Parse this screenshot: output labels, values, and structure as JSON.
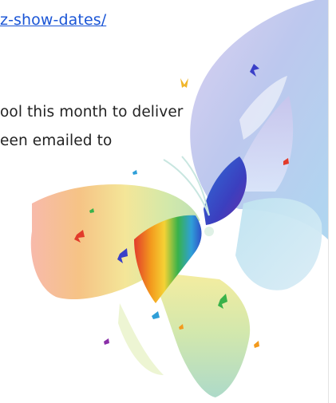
{
  "page": {
    "link_text": "z-show-dates/",
    "paragraph_line_1": "ool this month to deliver",
    "paragraph_line_2": "een emailed to"
  },
  "image": {
    "subject": "butterfly-illustration",
    "palette": {
      "upper_wing_left": "#b9b3e6",
      "upper_wing_right": "#9fc0e8",
      "lower_wing_warm": "#f2a96f",
      "lower_wing_yellow": "#f2e58b",
      "lower_wing_green": "#bde0a0",
      "body_blue": "#2f6fd8",
      "body_red": "#e23b2b",
      "body_orange": "#f39a1d",
      "body_green": "#38b24a",
      "link_color": "#1a55d6"
    }
  }
}
